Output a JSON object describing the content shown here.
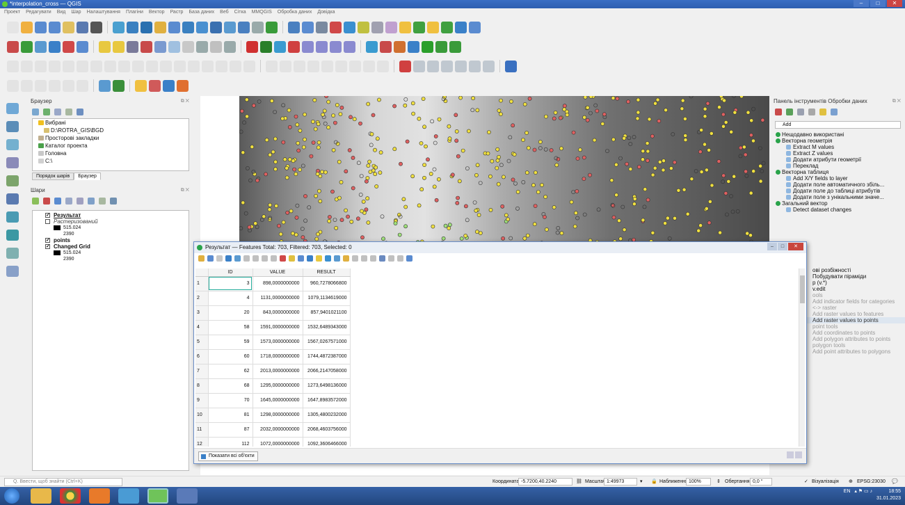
{
  "window": {
    "title": "*interpolation_cross — QGIS"
  },
  "menu": [
    "Проект",
    "Редагувати",
    "Вид",
    "Шар",
    "Налаштування",
    "Плагіни",
    "Вектор",
    "Растр",
    "База даних",
    "Веб",
    "Сітка",
    "MMQGIS",
    "Обробка даних",
    "Довідка"
  ],
  "browser": {
    "title": "Браузер",
    "tree": [
      {
        "label": "Вибрані",
        "icon": "star-icon"
      },
      {
        "label": "D:\\ROTRA_GIS\\BGD",
        "icon": "folder-icon"
      },
      {
        "label": "Просторові закладки",
        "icon": "bookmark-icon"
      },
      {
        "label": "Каталог проекта",
        "icon": "project-icon"
      },
      {
        "label": "Головна",
        "icon": "home-icon"
      },
      {
        "label": "C:\\",
        "icon": "drive-icon"
      }
    ],
    "tabs": [
      "Порядок шарів",
      "Браузер"
    ]
  },
  "layers": {
    "title": "Шари",
    "items": [
      {
        "name": "Результат",
        "checked": "✓",
        "style": "bold"
      },
      {
        "name": "Растеризований",
        "checked": "",
        "style": "italic"
      },
      {
        "legend": [
          "515.024",
          "2390"
        ]
      },
      {
        "name": "points",
        "checked": "✓",
        "style": "normal"
      },
      {
        "name": "Changed Grid",
        "checked": "✓",
        "style": "boldplain"
      },
      {
        "legend": [
          "515.024",
          "2390"
        ]
      }
    ]
  },
  "processing": {
    "title": "Панель інструментів Обробки даних",
    "search": "Add",
    "rows": [
      {
        "type": "group",
        "label": "Нещодавно використані"
      },
      {
        "type": "group",
        "label": "Векторна геометрія"
      },
      {
        "type": "item",
        "label": "Extract M values"
      },
      {
        "type": "item",
        "label": "Extract Z values"
      },
      {
        "type": "item",
        "label": "Додати атрибути геометрії"
      },
      {
        "type": "item",
        "label": "Переклад"
      },
      {
        "type": "group",
        "label": "Векторна таблиця"
      },
      {
        "type": "item",
        "label": "Add X/Y fields to layer"
      },
      {
        "type": "item",
        "label": "Додати поле автоматичного збіль..."
      },
      {
        "type": "item",
        "label": "Додати поле до таблиці атрибутів"
      },
      {
        "type": "item",
        "label": "Додати поле з унікальними значе..."
      },
      {
        "type": "group",
        "label": "Загальний вектор"
      },
      {
        "type": "item",
        "label": "Detect dataset changes"
      }
    ],
    "lower_rows": [
      {
        "label": "ові розбіжності",
        "style": "plain"
      },
      {
        "label": "Побудувати піраміди",
        "style": "plain"
      },
      {
        "label": "р (v.*)",
        "style": "plain"
      },
      {
        "label": "v.edit",
        "style": "plain"
      },
      {
        "label": "ools",
        "style": "faint"
      },
      {
        "label": "Add indicator fields for categories",
        "style": "faint"
      },
      {
        "label": "<-> raster",
        "style": "faint"
      },
      {
        "label": "Add raster values to features",
        "style": "faint"
      },
      {
        "label": "Add raster values to points",
        "style": "hl"
      },
      {
        "label": "point tools",
        "style": "faint"
      },
      {
        "label": "Add coordinates to points",
        "style": "faint"
      },
      {
        "label": "Add polygon attributes to points",
        "style": "faint"
      },
      {
        "label": "polygon tools",
        "style": "faint"
      },
      {
        "label": "Add point attributes to polygons",
        "style": "faint"
      }
    ]
  },
  "attr_table": {
    "title": "Результат — Features Total: 703, Filtered: 703, Selected: 0",
    "columns": [
      "ID",
      "VALUE",
      "RESULT"
    ],
    "rows": [
      [
        "1",
        "3",
        "898,0000000000",
        "960,7278066800"
      ],
      [
        "2",
        "4",
        "1131,0000000000",
        "1079,1134619000"
      ],
      [
        "3",
        "20",
        "843,0000000000",
        "857,9401021100"
      ],
      [
        "4",
        "58",
        "1591,0000000000",
        "1532,6489343000"
      ],
      [
        "5",
        "59",
        "1573,0000000000",
        "1567,0267571000"
      ],
      [
        "6",
        "60",
        "1718,0000000000",
        "1744,4872387000"
      ],
      [
        "7",
        "62",
        "2013,0000000000",
        "2066,2147058000"
      ],
      [
        "8",
        "68",
        "1295,0000000000",
        "1273,6498136000"
      ],
      [
        "9",
        "70",
        "1645,0000000000",
        "1647,8983572000"
      ],
      [
        "10",
        "81",
        "1298,0000000000",
        "1305,4800232000"
      ],
      [
        "11",
        "87",
        "2032,0000000000",
        "2068,4603756000"
      ],
      [
        "12",
        "112",
        "1072,0000000000",
        "1092,3606466000"
      ]
    ],
    "show_all": "Показати всі об'єкти"
  },
  "status": {
    "locator": "Q. Ввести, щоб знайти (Ctrl+K)",
    "coord_label": "Координата",
    "coord": "-5.7200,40.2240",
    "scale_label": "Масштаб",
    "scale": "1:49973",
    "magnifier_label": "Наближення",
    "magnifier": "100%",
    "rotation_label": "Обертання",
    "rotation": "0,0 °",
    "render": "Візуалізація",
    "crs": "EPSG:23030"
  },
  "tray": {
    "lang": "EN",
    "time": "18:55",
    "date": "31.01.2023"
  }
}
